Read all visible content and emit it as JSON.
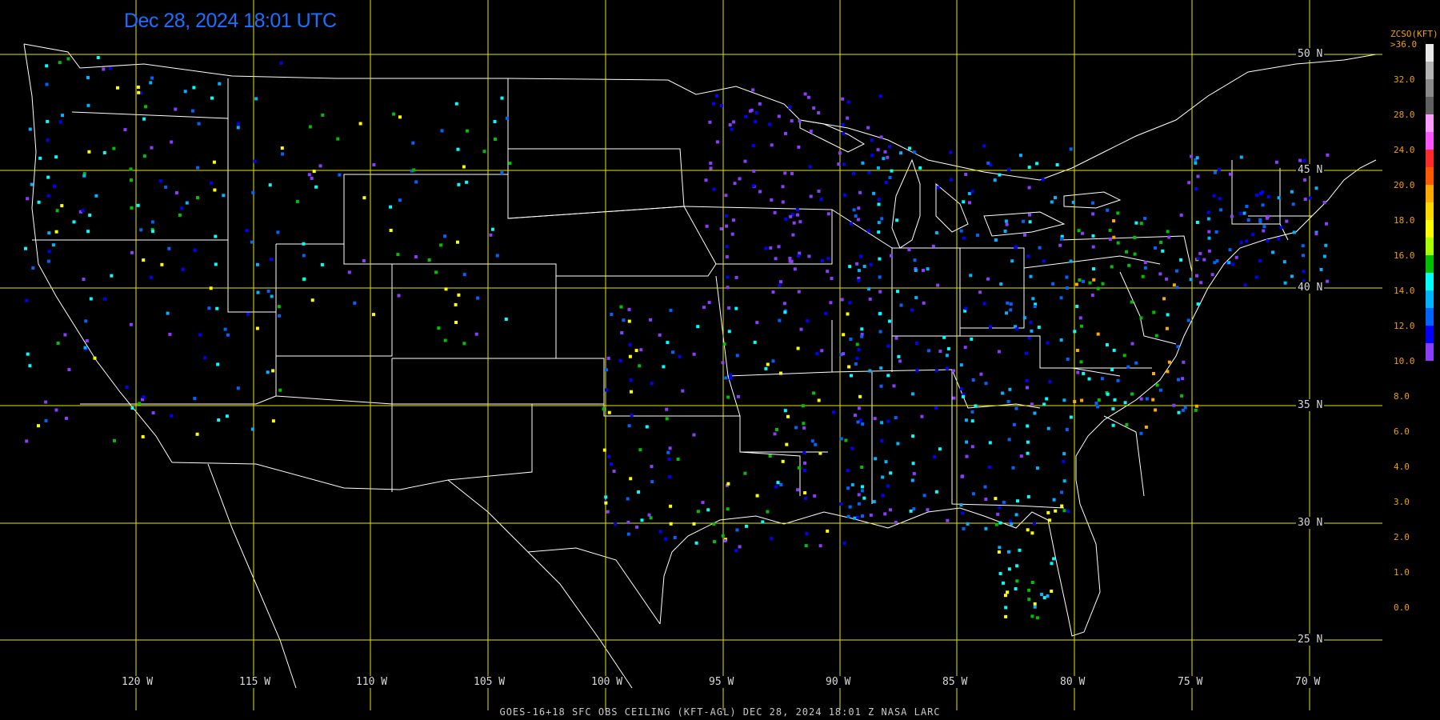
{
  "title": "Dec 28, 2024 18:01 UTC",
  "footer": "GOES-16+18  SFC OBS CEILING (KFT-AGL)   DEC 28, 2024 18:01 Z   NASA LARC",
  "lat_labels": [
    "50 N",
    "45 N",
    "40 N",
    "35 N",
    "30 N",
    "25 N"
  ],
  "lon_labels": [
    "120 W",
    "115 W",
    "110 W",
    "105 W",
    "100 W",
    "95 W",
    "90 W",
    "85 W",
    "80 W",
    "75 W",
    "70 W"
  ],
  "colorbar": {
    "title": "ZCSO(KFT)",
    "top_label": ">36.0",
    "ticks": [
      "32.0",
      "28.0",
      "24.0",
      "20.0",
      "18.0",
      "16.0",
      "14.0",
      "12.0",
      "10.0",
      "8.0",
      "6.0",
      "4.0",
      "3.0",
      "2.0",
      "1.0",
      "0.0"
    ],
    "colors": [
      "#e8e8e8",
      "#b4b4b4",
      "#8a8a8a",
      "#606060",
      "#ff9cff",
      "#ff55ff",
      "#ff2a2a",
      "#ff5a00",
      "#ffaa00",
      "#ffd800",
      "#ffff00",
      "#a8ff00",
      "#00c000",
      "#00ffff",
      "#00b4ff",
      "#0064ff",
      "#0000ff",
      "#8c3cff"
    ]
  },
  "colors": {
    "grid": "#e6e600",
    "boundary": "#ffffff",
    "title": "#1e6fff",
    "axis_text": "#f0a000"
  }
}
